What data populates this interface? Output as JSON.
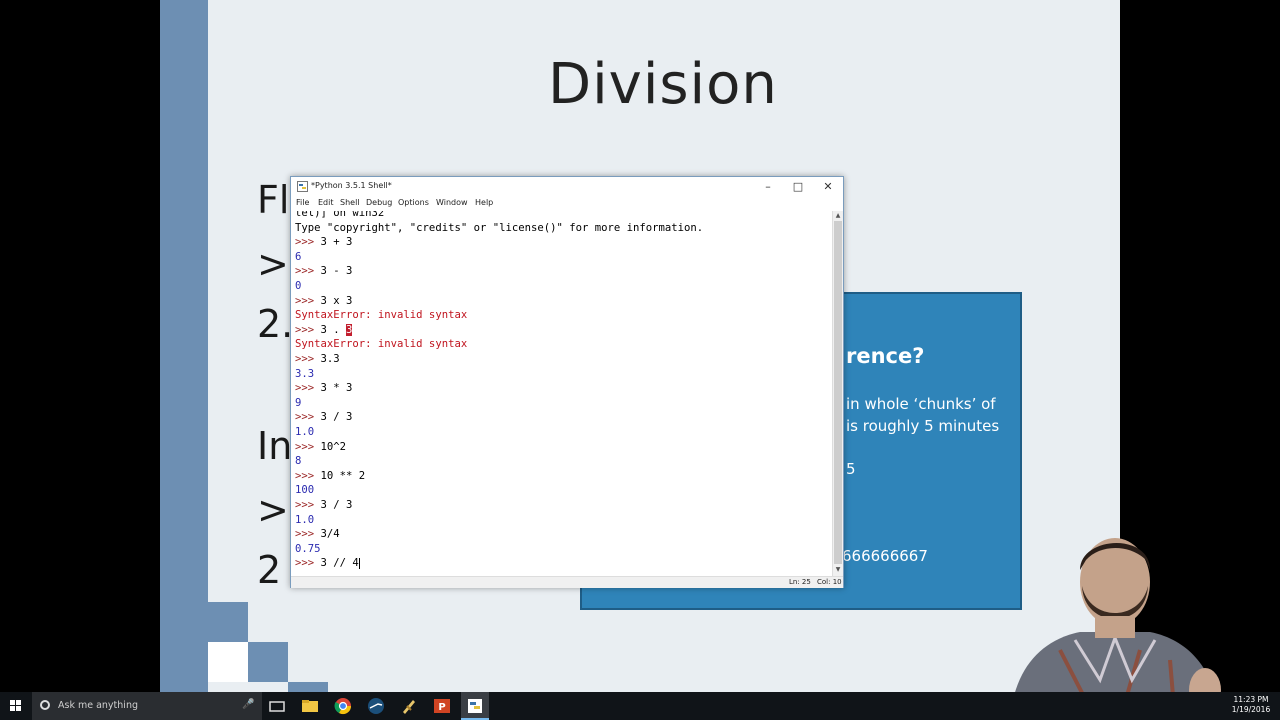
{
  "slide": {
    "title": "Division",
    "fragments": [
      "Fl",
      ">>",
      "2.",
      "In",
      ">>",
      "2"
    ],
    "box": {
      "heading": "rence?",
      "line1": "in whole ‘chunks’ of",
      "line2": "is roughly 5 minutes",
      "line3": "5",
      "line4": "666666667"
    }
  },
  "window": {
    "title": "*Python 3.5.1 Shell*",
    "menu": [
      "File",
      "Edit",
      "Shell",
      "Debug",
      "Options",
      "Window",
      "Help"
    ],
    "status": {
      "ln": "Ln: 25",
      "col": "Col: 10"
    }
  },
  "shell_lines": [
    {
      "prompt": "",
      "text": "tel)] on win32",
      "kind": "out-plain"
    },
    {
      "prompt": "",
      "text": "Type \"copyright\", \"credits\" or \"license()\" for more information.",
      "kind": "out-plain"
    },
    {
      "prompt": ">>> ",
      "text": "3 + 3",
      "kind": "in"
    },
    {
      "prompt": "",
      "text": "6",
      "kind": "out"
    },
    {
      "prompt": ">>> ",
      "text": "3 - 3",
      "kind": "in"
    },
    {
      "prompt": "",
      "text": "0",
      "kind": "out"
    },
    {
      "prompt": ">>> ",
      "text": "3 x 3",
      "kind": "in"
    },
    {
      "prompt": "",
      "text": "SyntaxError: invalid syntax",
      "kind": "err"
    },
    {
      "prompt": ">>> ",
      "text": "3 . ",
      "sel": "3",
      "kind": "in"
    },
    {
      "prompt": "",
      "text": "SyntaxError: invalid syntax",
      "kind": "err"
    },
    {
      "prompt": ">>> ",
      "text": "3.3",
      "kind": "in"
    },
    {
      "prompt": "",
      "text": "3.3",
      "kind": "out"
    },
    {
      "prompt": ">>> ",
      "text": "3 * 3",
      "kind": "in"
    },
    {
      "prompt": "",
      "text": "9",
      "kind": "out"
    },
    {
      "prompt": ">>> ",
      "text": "3 / 3",
      "kind": "in"
    },
    {
      "prompt": "",
      "text": "1.0",
      "kind": "out"
    },
    {
      "prompt": ">>> ",
      "text": "10^2",
      "kind": "in"
    },
    {
      "prompt": "",
      "text": "8",
      "kind": "out"
    },
    {
      "prompt": ">>> ",
      "text": "10 ** 2",
      "kind": "in"
    },
    {
      "prompt": "",
      "text": "100",
      "kind": "out"
    },
    {
      "prompt": ">>> ",
      "text": "3 / 3",
      "kind": "in"
    },
    {
      "prompt": "",
      "text": "1.0",
      "kind": "out"
    },
    {
      "prompt": ">>> ",
      "text": "3/4",
      "kind": "in"
    },
    {
      "prompt": "",
      "text": "0.75",
      "kind": "out"
    },
    {
      "prompt": ">>> ",
      "text": "3 // 4",
      "kind": "in",
      "cursor": true
    }
  ],
  "taskbar": {
    "search_placeholder": "Ask me anything",
    "time": "11:23 PM",
    "date": "1/19/2016",
    "icons": [
      "task-view-icon",
      "file-explorer-icon",
      "chrome-icon",
      "steam-icon",
      "app-icon",
      "powerpoint-icon",
      "idle-icon"
    ]
  },
  "colors": {
    "slide_bg": "#e9eef2",
    "stripe": "#6d8fb3",
    "box": "#2f84b9",
    "prompt": "#9c2929",
    "output": "#2b2bb0",
    "error": "#c0141e"
  }
}
